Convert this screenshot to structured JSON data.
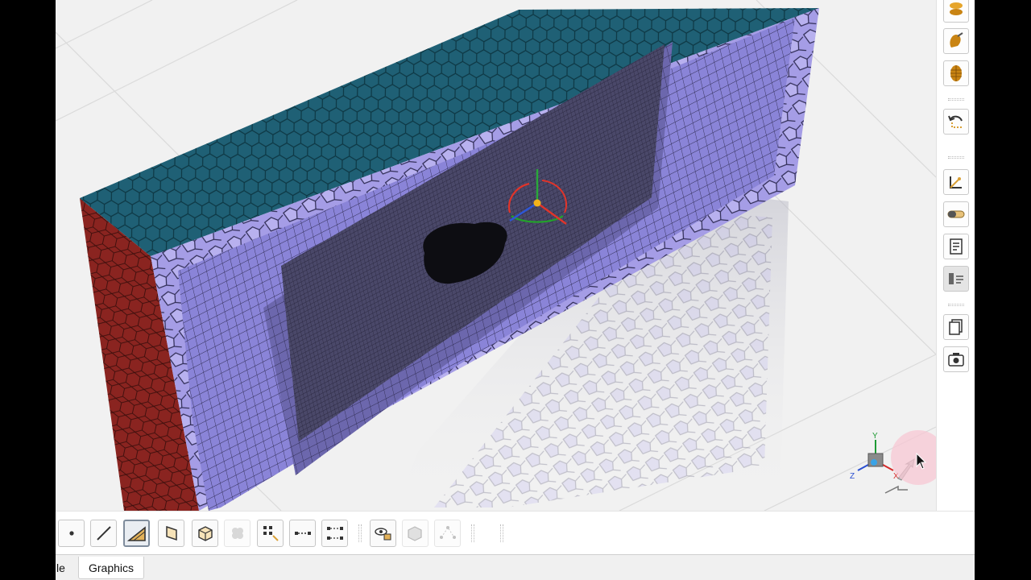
{
  "app": {
    "bottom_tabs": [
      {
        "label": "le"
      },
      {
        "label": "Graphics"
      }
    ]
  },
  "viewport": {
    "content": "mesh-model-viewport",
    "triad_labels": {
      "y": "Y",
      "x": "X",
      "z": "Z"
    }
  },
  "colors": {
    "hex_face": "#1f6075",
    "side_face": "#8a2420",
    "poly_mesh": "#a59de6",
    "hex_mesh": "#8a84d8",
    "dense_mesh": "#4a4869",
    "floor": "#f1f1f1",
    "halo": "#f5c4d0"
  },
  "right_toolbar": [
    {
      "name": "color-layers-icon"
    },
    {
      "name": "draw-tilt-icon"
    },
    {
      "name": "mesh-display-icon"
    },
    {
      "name": "undo-view-icon"
    },
    {
      "name": "triad-axis-icon"
    },
    {
      "name": "ruler-icon"
    },
    {
      "name": "report-icon"
    },
    {
      "name": "layout-icon"
    },
    {
      "name": "copy-icon"
    },
    {
      "name": "screenshot-icon"
    }
  ],
  "bottom_toolbar": [
    {
      "name": "select-point-icon",
      "state": "normal"
    },
    {
      "name": "select-edge-icon",
      "state": "normal"
    },
    {
      "name": "select-face-icon",
      "state": "active"
    },
    {
      "name": "select-body-face-icon",
      "state": "normal"
    },
    {
      "name": "select-body-icon",
      "state": "normal"
    },
    {
      "name": "select-cells-icon",
      "state": "disabled"
    },
    {
      "name": "box-select-icon",
      "state": "normal"
    },
    {
      "name": "select-connected-icon",
      "state": "normal"
    },
    {
      "name": "select-grow-icon",
      "state": "normal"
    },
    {
      "name": "view-selection-icon",
      "state": "normal"
    },
    {
      "name": "select-hidden-icon",
      "state": "disabled"
    },
    {
      "name": "select-nodes-icon",
      "state": "disabled"
    }
  ]
}
